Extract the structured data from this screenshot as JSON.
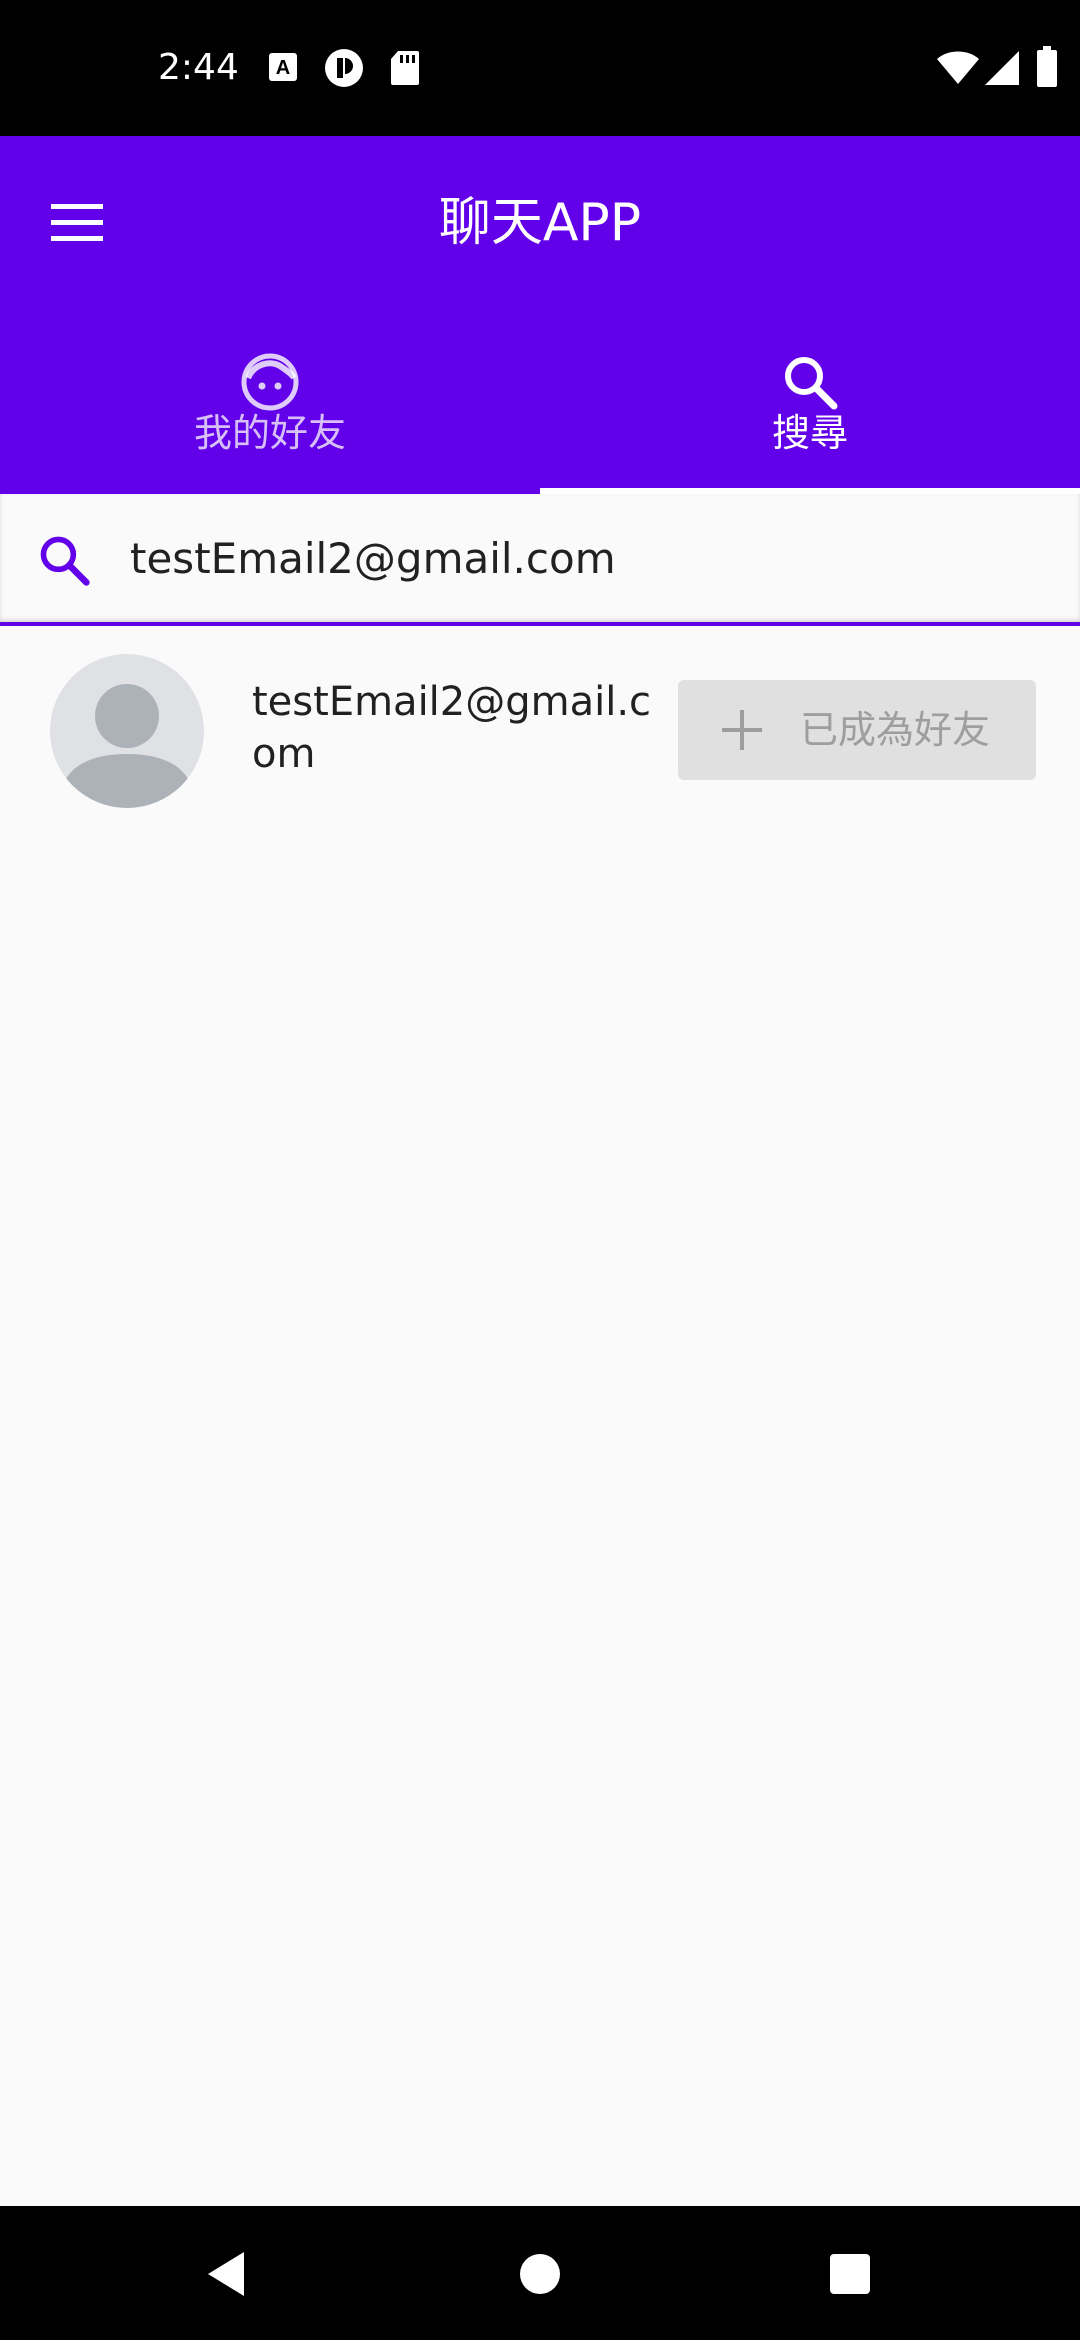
{
  "status_bar": {
    "time": "2:44",
    "icons": [
      "a-notification-icon",
      "privacy-icon",
      "sd-card-icon",
      "wifi-icon",
      "signal-icon",
      "battery-icon"
    ]
  },
  "app_bar": {
    "title": "聊天APP",
    "menu_icon": "hamburger-menu-icon",
    "background": "#6200ea"
  },
  "tabs": [
    {
      "label": "我的好友",
      "icon": "face-icon",
      "selected": false
    },
    {
      "label": "搜尋",
      "icon": "search-icon",
      "selected": true
    }
  ],
  "search": {
    "value": "testEmail2@gmail.com",
    "icon": "search-icon",
    "accent": "#6200ea"
  },
  "results": [
    {
      "email": "testEmail2@gmail.com",
      "button_label": "已成為好友",
      "button_icon": "plus-icon",
      "button_enabled": false
    }
  ],
  "nav_bar": {
    "buttons": [
      "back-icon",
      "home-icon",
      "recents-icon"
    ]
  }
}
